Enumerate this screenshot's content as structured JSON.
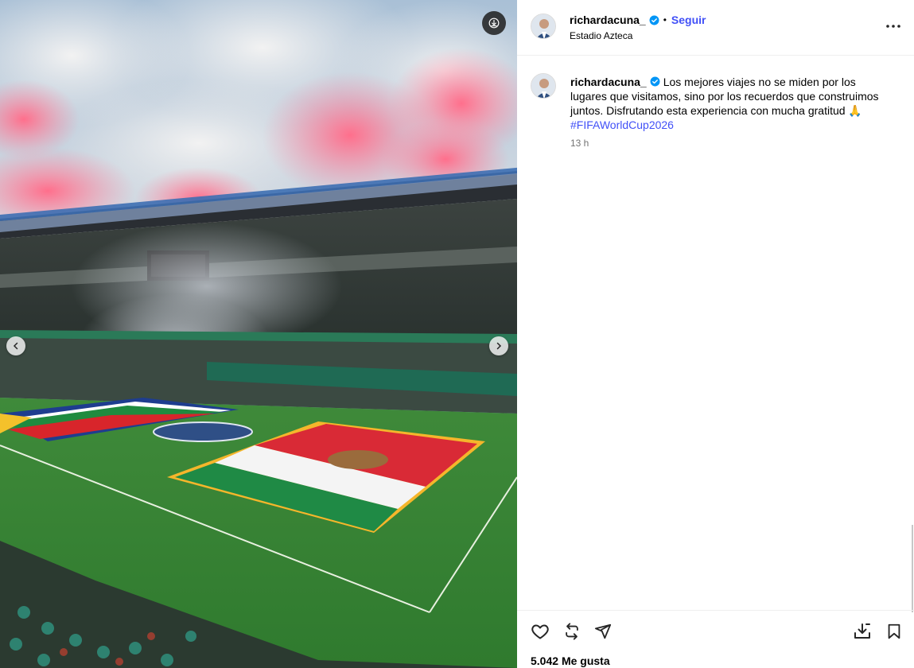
{
  "post": {
    "username": "richardacuna_",
    "follow_label": "Seguir",
    "separator": "•",
    "location": "Estadio Azteca",
    "caption_text": "Los mejores viajes no se miden por los lugares que visitamos, sino por los recuerdos que construimos juntos. Disfrutando esta experiencia con mucha gratitud 🙏",
    "hashtag": "#FIFAWorldCup2026",
    "time_ago": "13 h",
    "likes_count": "5.042",
    "likes_label": "Me gusta"
  },
  "icons": {
    "download": "download-icon",
    "prev": "chevron-left-icon",
    "next": "chevron-right-icon",
    "more": "more-options-icon",
    "like": "heart-icon",
    "repost": "repost-icon",
    "share": "share-icon",
    "save_download": "download-tray-icon",
    "bookmark": "bookmark-icon",
    "verified": "verified-badge-icon"
  },
  "colors": {
    "accent": "#4150f7",
    "verified": "#0095f6",
    "muted": "#737373"
  }
}
